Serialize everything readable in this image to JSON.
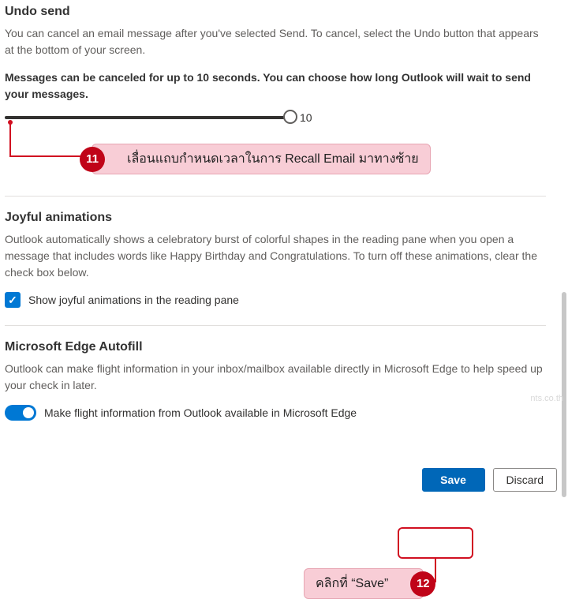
{
  "undoSend": {
    "title": "Undo send",
    "desc": "You can cancel an email message after you've selected Send. To cancel, select the Undo button that appears at the bottom of your screen.",
    "sliderLabel": "Messages can be canceled for up to 10 seconds. You can choose how long Outlook will wait to send your messages.",
    "sliderValue": "10"
  },
  "joyful": {
    "title": "Joyful animations",
    "desc": "Outlook automatically shows a celebratory burst of colorful shapes in the reading pane when you open a message that includes words like Happy Birthday and Congratulations. To turn off these animations, clear the check box below.",
    "checkboxLabel": "Show joyful animations in the reading pane",
    "checked": true
  },
  "edge": {
    "title": "Microsoft Edge Autofill",
    "desc": "Outlook can make flight information in your inbox/mailbox available directly in Microsoft Edge to help speed up your check in later.",
    "toggleLabel": "Make flight information from Outlook available in Microsoft Edge",
    "toggled": true
  },
  "footer": {
    "save": "Save",
    "discard": "Discard"
  },
  "annotations": {
    "step11_num": "11",
    "step11_text": "เลื่อนแถบกำหนดเวลาในการ Recall Email มาทางซ้าย",
    "step12_num": "12",
    "step12_text": "คลิกที่ “Save”"
  },
  "watermark": "nts.co.th"
}
